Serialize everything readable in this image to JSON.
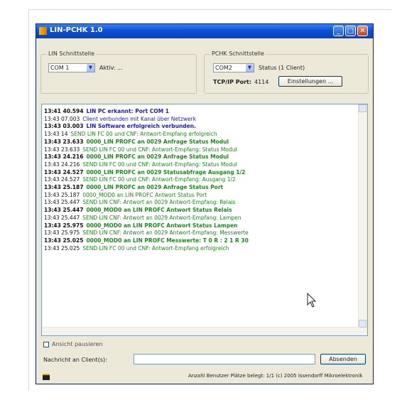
{
  "window": {
    "title": "LIN-PCHK 1.0",
    "buttons": [
      "_",
      "□",
      "✕"
    ]
  },
  "group_left": {
    "label": "LIN Schnittstelle",
    "port_value": "COM 1",
    "port_text": "Aktiv: ..."
  },
  "group_right": {
    "label": "PCHK Schnittstelle",
    "port_value": "COM2",
    "port_text": "Status (1 Client)",
    "tcp_label": "TCP/IP Port:",
    "tcp_value": "4114",
    "config_button": "Einstellungen ..."
  },
  "log": [
    {
      "t": "13:41 40.594",
      "m": "LIN PC erkannt: Port COM 1",
      "c": "#1a1ad0",
      "b": true
    },
    {
      "t": "13:43 07.003",
      "m": "Client verbunden mit Kanal über Netzwerk",
      "c": "#1a1ad0",
      "b": false
    },
    {
      "t": "13:43 03.003",
      "m": "LIN Software erfolgreich verbunden.",
      "c": "#1a1ad0",
      "b": true
    },
    {
      "t": "13:43 14",
      "m": "SEND LIN FC 00 und CNF: Antwort-Empfang erfolgreich",
      "c": "#1a8a1a",
      "b": false
    },
    {
      "t": "13:43 23.633",
      "m": "0000_LIN PROFC an 0029 Anfrage Status Modul",
      "c": "#1a8a1a",
      "b": true
    },
    {
      "t": "13:43 23.633",
      "m": "SEND LIN FC 00 und CNF: Antwort-Empfang: Status Modul",
      "c": "#1a8a1a",
      "b": false
    },
    {
      "t": "13:43 24.216",
      "m": "0000_LIN PROFC an 0029 Anfrage Status Modul",
      "c": "#1a8a1a",
      "b": true
    },
    {
      "t": "13:43 24.216",
      "m": "SEND LIN FC 00 und CNF: Antwort-Empfang: Status Modul",
      "c": "#1a8a1a",
      "b": false
    },
    {
      "t": "13:43 24.527",
      "m": "0000_LIN PROFC an 0029 Statusabfrage Ausgang 1/2",
      "c": "#1a8a1a",
      "b": true
    },
    {
      "t": "13:43 24.527",
      "m": "SEND LIN FC 00 und CNF: Antwort-Empfang: Ausgang 1/2",
      "c": "#1a8a1a",
      "b": false
    },
    {
      "t": "13:43 25.187",
      "m": "0000_LIN PROFC an 0029 Anfrage Status Port",
      "c": "#1a8a1a",
      "b": true
    },
    {
      "t": "13:43 25.187",
      "m": "0000_MOD0 an LIN PROFC Antwort Status Port",
      "c": "#1a8a1a",
      "b": false
    },
    {
      "t": "13:43 25.447",
      "m": "SEND LIN CNF: Antwort an 0029 Antwort-Empfang: Relais",
      "c": "#1a8a1a",
      "b": false
    },
    {
      "t": "13:43 25.447",
      "m": "0000_MOD0 an LIN PROFC Antwort Status Relais",
      "c": "#1a8a1a",
      "b": true
    },
    {
      "t": "13:43 25.447",
      "m": "SEND LIN CNF: Antwort an 0029 Antwort-Empfang: Lampen",
      "c": "#1a8a1a",
      "b": false
    },
    {
      "t": "13:43 25.975",
      "m": "0000_MOD0 an LIN PROFC Antwort Status Lampen",
      "c": "#1a8a1a",
      "b": true
    },
    {
      "t": "13:43 25.975",
      "m": "SEND LIN CNF: Antwort an 0029 Antwort-Empfang: Messwerte",
      "c": "#1a8a1a",
      "b": false
    },
    {
      "t": "13:43 25.025",
      "m": "0000_MOD0 an LIN PROFC Messwerte: T 0 R : 2 1 R 30",
      "c": "#1a8a1a",
      "b": true
    },
    {
      "t": "13:43 25.025",
      "m": "SEND LIN FC 00 und CNF: Antwort-Empfang erfolgreich",
      "c": "#1a8a1a",
      "b": false
    }
  ],
  "checkbox_label": "Ansicht pausieren",
  "message_label": "Nachricht an Client(s):",
  "send_button": "Absenden",
  "status_text": "Anzahl Benutzer Plätze belegt: 1/1 (c) 2005 Issendorff Mikroelektronik"
}
